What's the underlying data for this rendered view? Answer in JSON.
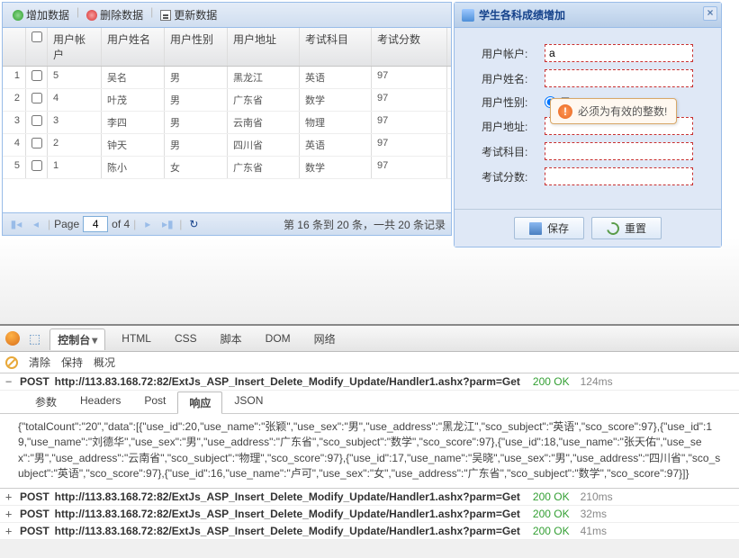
{
  "toolbar": {
    "add": "增加数据",
    "del": "删除数据",
    "upd": "更新数据"
  },
  "grid": {
    "cols": [
      "用户帐户",
      "用户姓名",
      "用户性别",
      "用户地址",
      "考试科目",
      "考试分数"
    ],
    "rows": [
      {
        "n": "1",
        "acct": "5",
        "name": "吴名",
        "sex": "男",
        "addr": "黑龙江",
        "subj": "英语",
        "score": "97"
      },
      {
        "n": "2",
        "acct": "4",
        "name": "叶茂",
        "sex": "男",
        "addr": "广东省",
        "subj": "数学",
        "score": "97"
      },
      {
        "n": "3",
        "acct": "3",
        "name": "李四",
        "sex": "男",
        "addr": "云南省",
        "subj": "物理",
        "score": "97"
      },
      {
        "n": "4",
        "acct": "2",
        "name": "钟天",
        "sex": "男",
        "addr": "四川省",
        "subj": "英语",
        "score": "97"
      },
      {
        "n": "5",
        "acct": "1",
        "name": "陈小",
        "sex": "女",
        "addr": "广东省",
        "subj": "数学",
        "score": "97"
      }
    ]
  },
  "pager": {
    "label": "Page",
    "page": "4",
    "of": "of 4",
    "status": "第 16 条到 20 条，一共 20 条记录"
  },
  "form": {
    "title": "学生各科成绩增加",
    "labels": {
      "acct": "用户帐户:",
      "name": "用户姓名:",
      "sex": "用户性别:",
      "addr": "用户地址:",
      "subj": "考试科目:",
      "score": "考试分数:"
    },
    "acct_val": "a",
    "sex_opt": "男",
    "save": "保存",
    "reset": "重置"
  },
  "tooltip": {
    "msg": "必须为有效的整数!"
  },
  "fb": {
    "tabs": [
      "控制台",
      "HTML",
      "CSS",
      "脚本",
      "DOM",
      "网络"
    ],
    "sub": [
      "清除",
      "保持",
      "概况"
    ],
    "reqTabs": [
      "参数",
      "Headers",
      "Post",
      "响应",
      "JSON"
    ],
    "reqs": [
      {
        "open": true,
        "m": "POST",
        "u": "http://113.83.168.72:82/ExtJs_ASP_Insert_Delete_Modify_Update/Handler1.ashx?parm=Get",
        "s": "200 OK",
        "t": "124ms"
      },
      {
        "open": false,
        "m": "POST",
        "u": "http://113.83.168.72:82/ExtJs_ASP_Insert_Delete_Modify_Update/Handler1.ashx?parm=Get",
        "s": "200 OK",
        "t": "210ms"
      },
      {
        "open": false,
        "m": "POST",
        "u": "http://113.83.168.72:82/ExtJs_ASP_Insert_Delete_Modify_Update/Handler1.ashx?parm=Get",
        "s": "200 OK",
        "t": "32ms"
      },
      {
        "open": false,
        "m": "POST",
        "u": "http://113.83.168.72:82/ExtJs_ASP_Insert_Delete_Modify_Update/Handler1.ashx?parm=Get",
        "s": "200 OK",
        "t": "41ms"
      }
    ],
    "response": "{\"totalCount\":\"20\",\"data\":[{\"use_id\":20,\"use_name\":\"张颖\",\"use_sex\":\"男\",\"use_address\":\"黑龙江\",\"sco_subject\":\"英语\",\"sco_score\":97},{\"use_id\":19,\"use_name\":\"刘德华\",\"use_sex\":\"男\",\"use_address\":\"广东省\",\"sco_subject\":\"数学\",\"sco_score\":97},{\"use_id\":18,\"use_name\":\"张天佑\",\"use_sex\":\"男\",\"use_address\":\"云南省\",\"sco_subject\":\"物理\",\"sco_score\":97},{\"use_id\":17,\"use_name\":\"吴晓\",\"use_sex\":\"男\",\"use_address\":\"四川省\",\"sco_subject\":\"英语\",\"sco_score\":97},{\"use_id\":16,\"use_name\":\"卢可\",\"use_sex\":\"女\",\"use_address\":\"广东省\",\"sco_subject\":\"数学\",\"sco_score\":97}]}"
  }
}
